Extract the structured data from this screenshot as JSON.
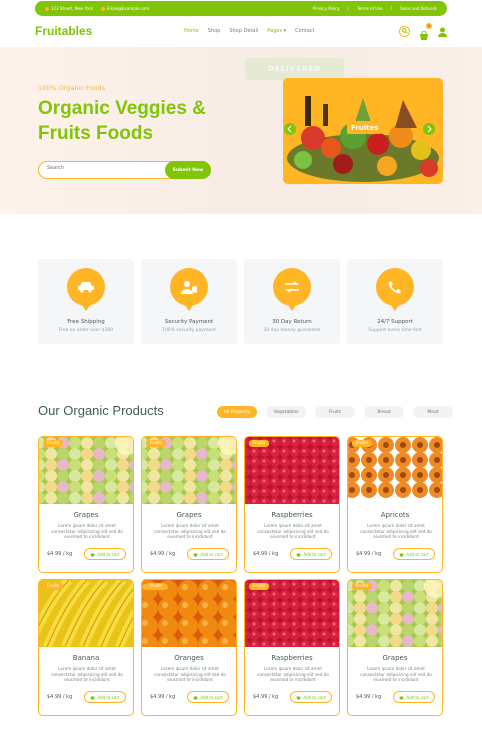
{
  "topbar": {
    "address": "123 Street, New York",
    "email": "Email@Example.com",
    "links": [
      "Privacy Policy",
      "Terms of Use",
      "Sales and Refunds"
    ]
  },
  "nav": {
    "logo": "Fruitables",
    "menu": [
      "Home",
      "Shop",
      "Shop Detail",
      "Pages",
      "Contact"
    ],
    "cart_count": "3"
  },
  "hero": {
    "tag": "100% Organic Foods",
    "title": "Organic Veggies & Fruits Foods",
    "search_placeholder": "Search",
    "search_button": "Submit Now",
    "carousel_label": "Fruites",
    "ghost_label": "DELIVERED"
  },
  "features": [
    {
      "title": "Free Shipping",
      "sub": "Free on order over $300",
      "icon": "car-icon"
    },
    {
      "title": "Security Payment",
      "sub": "100% security payment",
      "icon": "user-shield-icon"
    },
    {
      "title": "30 Day Return",
      "sub": "30 day money guarantee",
      "icon": "exchange-icon"
    },
    {
      "title": "24/7 Support",
      "sub": "Support every time fast",
      "icon": "phone-icon"
    }
  ],
  "products": {
    "heading": "Our Organic Products",
    "tabs": [
      "All Products",
      "Vegetables",
      "Fruits",
      "Bread",
      "Meat"
    ],
    "items": [
      {
        "badge": "Fruits",
        "name": "Grapes",
        "desc": "Lorem ipsum dolor sit amet consectetur adipisicing elit sed do eiusmod te incididunt",
        "price": "$4.99 / kg",
        "cart": "Add to cart"
      },
      {
        "badge": "Fruits",
        "name": "Grapes",
        "desc": "Lorem ipsum dolor sit amet consectetur adipisicing elit sed do eiusmod te incididunt",
        "price": "$4.99 / kg",
        "cart": "Add to cart"
      },
      {
        "badge": "Fruits",
        "name": "Raspberries",
        "desc": "Lorem ipsum dolor sit amet consectetur adipisicing elit sed do eiusmod te incididunt",
        "price": "$4.99 / kg",
        "cart": "Add to cart"
      },
      {
        "badge": "Fruits",
        "name": "Apricots",
        "desc": "Lorem ipsum dolor sit amet consectetur adipisicing elit sed do eiusmod te incididunt",
        "price": "$4.99 / kg",
        "cart": "Add to cart"
      },
      {
        "badge": "Fruits",
        "name": "Banana",
        "desc": "Lorem ipsum dolor sit amet consectetur adipisicing elit sed do eiusmod te incididunt",
        "price": "$4.99 / kg",
        "cart": "Add to cart"
      },
      {
        "badge": "Fruits",
        "name": "Oranges",
        "desc": "Lorem ipsum dolor sit amet consectetur adipisicing elit sed do eiusmod te incididunt",
        "price": "$4.99 / kg",
        "cart": "Add to cart"
      },
      {
        "badge": "Fruits",
        "name": "Raspberries",
        "desc": "Lorem ipsum dolor sit amet consectetur adipisicing elit sed do eiusmod te incididunt",
        "price": "$4.99 / kg",
        "cart": "Add to cart"
      },
      {
        "badge": "Fruits",
        "name": "Grapes",
        "desc": "Lorem ipsum dolor sit amet consectetur adipisicing elit sed do eiusmod te incididunt",
        "price": "$4.99 / kg",
        "cart": "Add to cart"
      }
    ]
  },
  "colors": {
    "primary": "#81c408",
    "secondary": "#ffb524",
    "text": "#45595b"
  }
}
